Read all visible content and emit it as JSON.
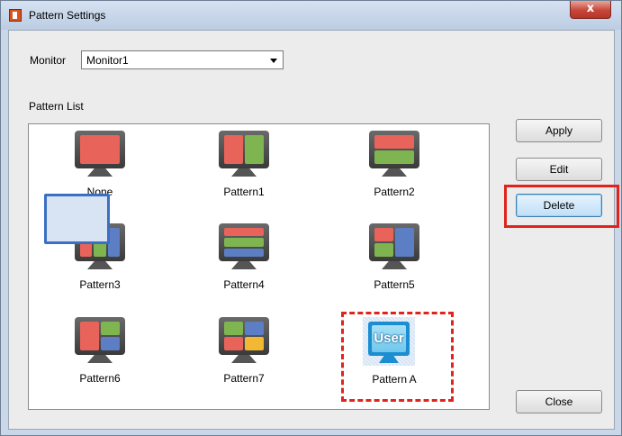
{
  "window": {
    "title": "Pattern Settings",
    "close_glyph": "x"
  },
  "monitor": {
    "label": "Monitor",
    "selected": "Monitor1"
  },
  "pattern_list": {
    "label": "Pattern List",
    "items": [
      {
        "label": "None"
      },
      {
        "label": "Pattern1"
      },
      {
        "label": "Pattern2"
      },
      {
        "label": "Pattern3"
      },
      {
        "label": "Pattern4"
      },
      {
        "label": "Pattern5"
      },
      {
        "label": "Pattern6",
        "selected": true
      },
      {
        "label": "Pattern7"
      },
      {
        "label": "Pattern A",
        "icon_text": "User"
      }
    ]
  },
  "buttons": {
    "apply": "Apply",
    "edit": "Edit",
    "delete": "Delete",
    "close": "Close"
  },
  "colors": {
    "red": "#e8635a",
    "green": "#7fb551",
    "blue": "#5b7ec4",
    "yellow": "#f2b733",
    "highlight": "#e0241b",
    "selection": "#3b6fc2"
  }
}
